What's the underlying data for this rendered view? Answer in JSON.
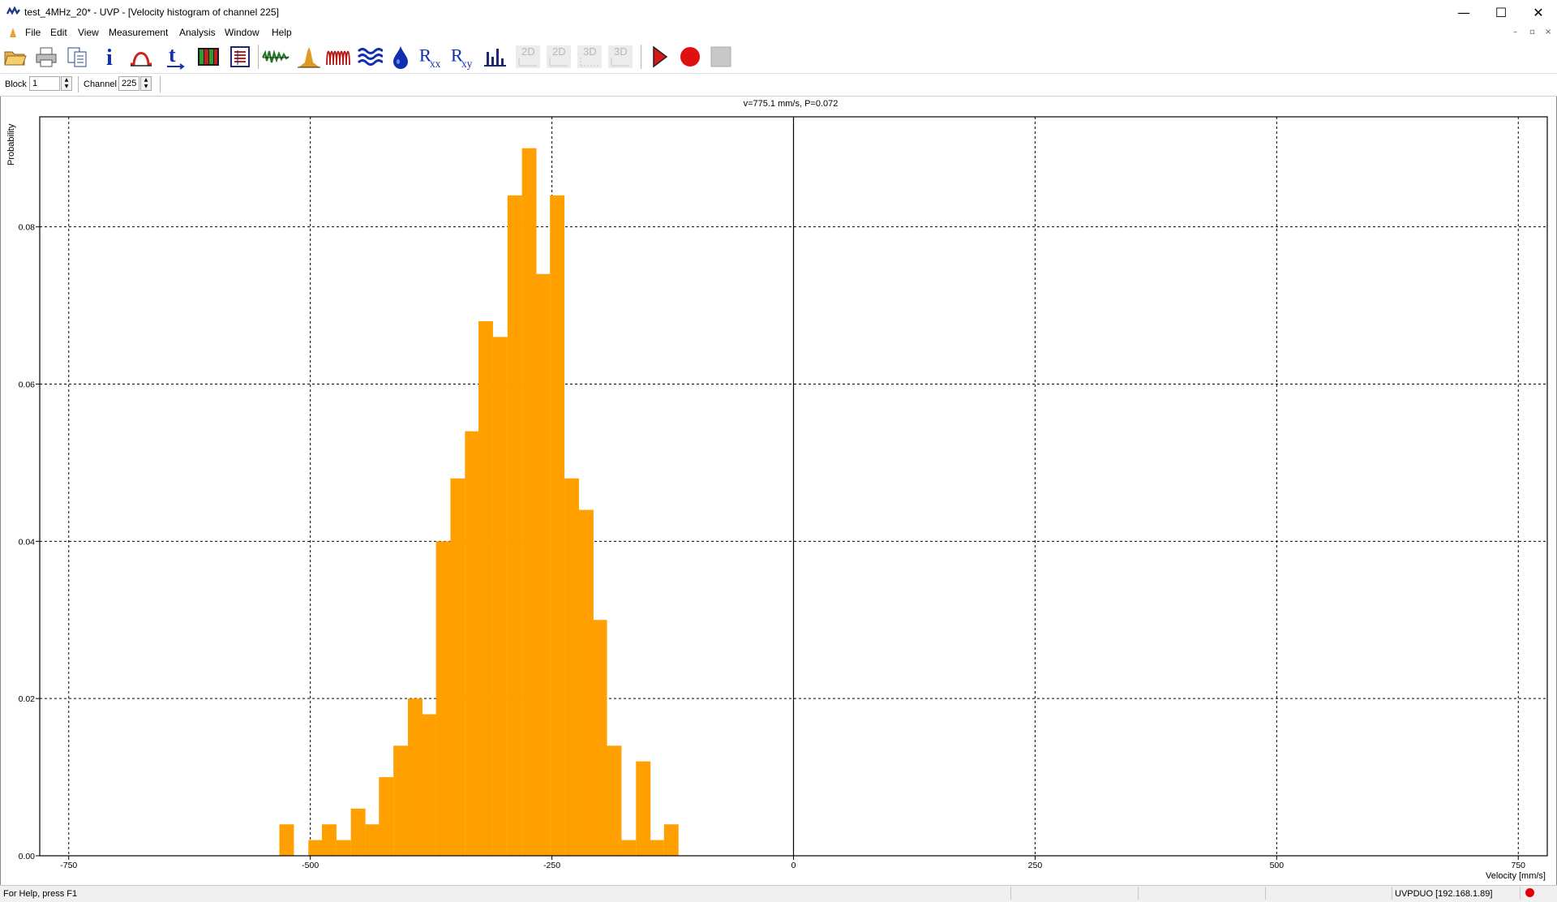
{
  "window": {
    "title": "test_4MHz_20* - UVP - [Velocity histogram of channel 225]",
    "minimize_glyph": "—",
    "maximize_glyph": "☐",
    "close_glyph": "✕"
  },
  "menu": {
    "items": [
      "File",
      "Edit",
      "View",
      "Measurement",
      "Analysis",
      "Window",
      "Help"
    ],
    "doc_minimize": "–",
    "doc_restore": "▫",
    "doc_close": "×"
  },
  "toolbar": {
    "buttons": [
      {
        "icon": "open-folder-icon",
        "enabled": true
      },
      {
        "icon": "print-icon",
        "enabled": true
      },
      {
        "icon": "copy-icon",
        "enabled": true
      },
      {
        "icon": "info-icon",
        "label": "i",
        "enabled": true
      },
      {
        "icon": "profile-icon",
        "enabled": true
      },
      {
        "icon": "time-axis-icon",
        "label": "t",
        "enabled": true
      },
      {
        "icon": "color-map-icon",
        "enabled": true
      },
      {
        "icon": "data-table-icon",
        "enabled": true
      },
      {
        "icon": "signal-icon",
        "enabled": true
      },
      {
        "icon": "histogram-peak-icon",
        "enabled": true
      },
      {
        "icon": "waveform-icon",
        "enabled": true
      },
      {
        "icon": "waves-icon",
        "enabled": true
      },
      {
        "icon": "drop-icon",
        "enabled": true
      },
      {
        "icon": "autocorrelation-icon",
        "label": "R",
        "sub": "xx",
        "enabled": true
      },
      {
        "icon": "crosscorrelation-icon",
        "label": "R",
        "sub": "xy",
        "enabled": true
      },
      {
        "icon": "bar-chart-icon",
        "enabled": true
      },
      {
        "icon": "view-2d-icon",
        "label": "2D",
        "enabled": false
      },
      {
        "icon": "view-2d-alt-icon",
        "label": "2D",
        "enabled": false
      },
      {
        "icon": "view-3d-icon",
        "label": "3D",
        "enabled": false
      },
      {
        "icon": "view-3d-alt-icon",
        "label": "3D",
        "enabled": false
      },
      {
        "icon": "play-icon",
        "enabled": true
      },
      {
        "icon": "record-icon",
        "enabled": true
      },
      {
        "icon": "stop-icon",
        "enabled": false
      }
    ]
  },
  "params": {
    "block_label": "Block",
    "block_value": "1",
    "channel_label": "Channel",
    "channel_value": "225"
  },
  "readout": "v=775.1 mm/s,  P=0.072",
  "chart_data": {
    "type": "bar",
    "title": "",
    "xlabel": "Velocity [mm/s]",
    "ylabel": "Probability",
    "xlim": [
      -780,
      780
    ],
    "ylim": [
      0,
      0.094
    ],
    "grid": true,
    "bar_color": "#ffa000",
    "bin_width": 14.7,
    "x_ticks": [
      -750,
      -500,
      -250,
      0,
      250,
      500,
      750
    ],
    "x_tick_labels": [
      "-750",
      "-500",
      "-250",
      "0",
      "250",
      "500",
      "750"
    ],
    "y_ticks": [
      0.0,
      0.02,
      0.04,
      0.06,
      0.08
    ],
    "y_tick_labels": [
      "0.00",
      "0.02",
      "0.04",
      "0.06",
      "0.08"
    ],
    "bin_left_edges": [
      -532,
      -502,
      -488,
      -473,
      -458,
      -443,
      -429,
      -414,
      -399,
      -385,
      -370,
      -355,
      -340,
      -326,
      -311,
      -296,
      -281,
      -267,
      -252,
      -237,
      -222,
      -208,
      -193,
      -178,
      -163,
      -149,
      -134
    ],
    "values": [
      0.004,
      0.002,
      0.004,
      0.002,
      0.006,
      0.004,
      0.01,
      0.014,
      0.02,
      0.018,
      0.04,
      0.048,
      0.054,
      0.068,
      0.066,
      0.084,
      0.09,
      0.074,
      0.084,
      0.048,
      0.044,
      0.03,
      0.014,
      0.002,
      0.012,
      0.002,
      0.004
    ]
  },
  "status": {
    "help_text": "For Help, press F1",
    "device": "UVPDUO [192.168.1.89]",
    "indicator_color": "#e00000"
  }
}
